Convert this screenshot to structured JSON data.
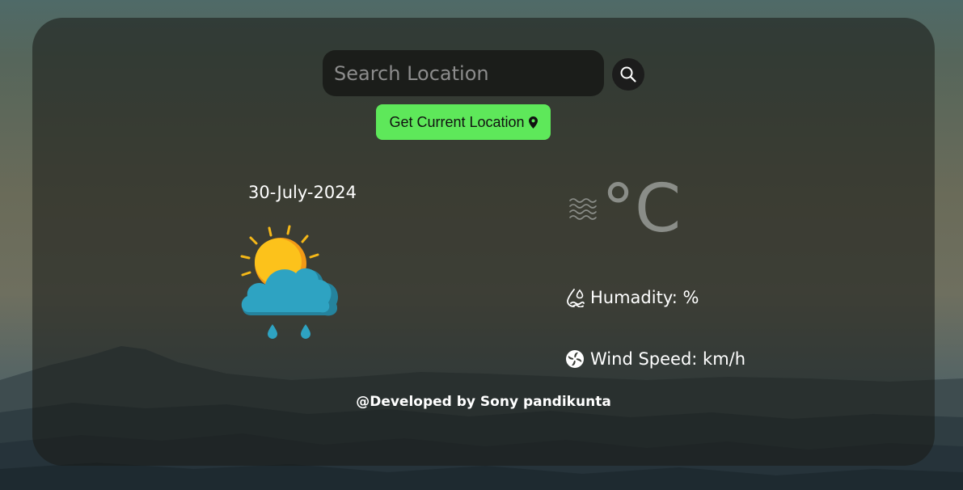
{
  "search": {
    "placeholder": "Search Location",
    "value": "",
    "icon": "search-icon"
  },
  "location_button": {
    "label": "Get Current Location",
    "icon": "map-pin-icon",
    "color": "#5ee85a"
  },
  "weather": {
    "date": "30-July-2024",
    "condition_icon": "sun-behind-rain-cloud-icon",
    "temperature_value": "",
    "temperature_unit": "°C",
    "temperature_icon": "mist-icon",
    "humidity_label": "Humadity: %",
    "humidity_icon": "humidity-icon",
    "wind_label": "Wind Speed: km/h",
    "wind_icon": "wind-fan-icon"
  },
  "footer": {
    "text": "@Developed by Sony pandikunta"
  }
}
